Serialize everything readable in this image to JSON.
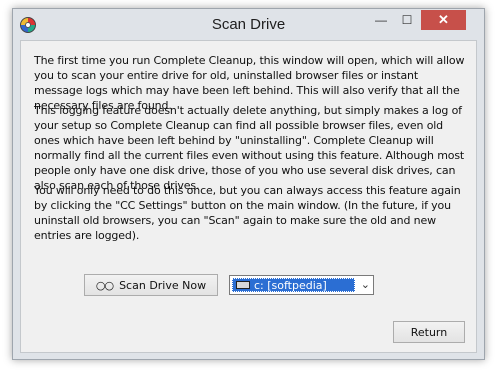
{
  "window": {
    "title": "Scan Drive",
    "minimize_glyph": "—",
    "maximize_glyph": "☐",
    "close_glyph": "✕"
  },
  "content": {
    "paragraph1": "The first time you run Complete Cleanup, this window will open, which will allow you to scan your entire drive for old, uninstalled browser files or instant message logs which may have been left behind. This will also verify that all the necessary files are found.",
    "paragraph2": "This logging feature doesn't actually delete anything, but simply makes a log of your setup so Complete Cleanup can find all possible browser files, even old ones which have been left behind by \"uninstalling\".  Complete Cleanup will normally find all the current files even without using this feature.  Although most people only have one disk drive, those of you who use several disk drives, can also scan each of those drives.",
    "paragraph3": "You will only need to do this once, but you can always access this feature again by clicking the \"CC Settings\" button on the main window. (In the future, if you uninstall old browsers, you can \"Scan\" again to make sure the old and new entries are logged)."
  },
  "controls": {
    "scan_button_icon": "glasses-icon",
    "scan_button_label": "Scan Drive Now",
    "drive_select_value": "c: [softpedia]",
    "return_button_label": "Return"
  }
}
